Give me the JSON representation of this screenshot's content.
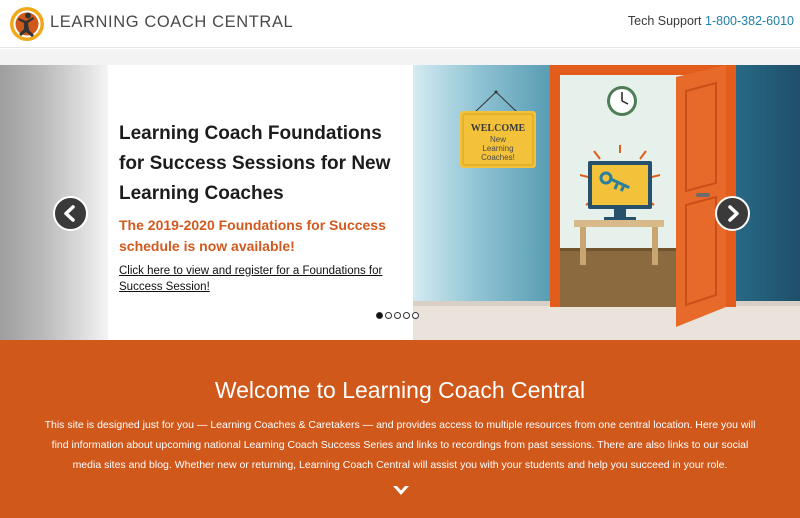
{
  "header": {
    "brand": "LEARNING COACH CENTRAL",
    "support_label": "Tech Support",
    "support_phone": "1-800-382-6010"
  },
  "carousel": {
    "title": "Learning Coach Foundations for Success Sessions for New Learning Coaches",
    "subtitle": "The 2019-2020 Foundations for Success schedule is now available!",
    "link": "Click here to view and register for a Foundations for Success Session!",
    "sign_line1": "WELCOME",
    "sign_line2": "New",
    "sign_line3": "Learning",
    "sign_line4": "Coaches!",
    "slide_count": 5,
    "active_slide": 1
  },
  "welcome": {
    "title": "Welcome to Learning Coach Central",
    "body": "This site is designed just for you — Learning Coaches & Caretakers — and provides access to multiple resources from one central location. Here you will find information about upcoming national Learning Coach Success Series and links to recordings from past sessions. There are also links to our social media sites and blog. Whether new or returning, Learning Coach Central will assist you with your students and help you succeed in your role."
  },
  "colors": {
    "accent": "#d0581b",
    "link_blue": "#1e7fa8",
    "teal_wall": "#2f7a96"
  },
  "icons": [
    "logo-icon",
    "arrow-left-icon",
    "arrow-right-icon",
    "chevron-down-icon",
    "clock-icon",
    "key-icon"
  ]
}
